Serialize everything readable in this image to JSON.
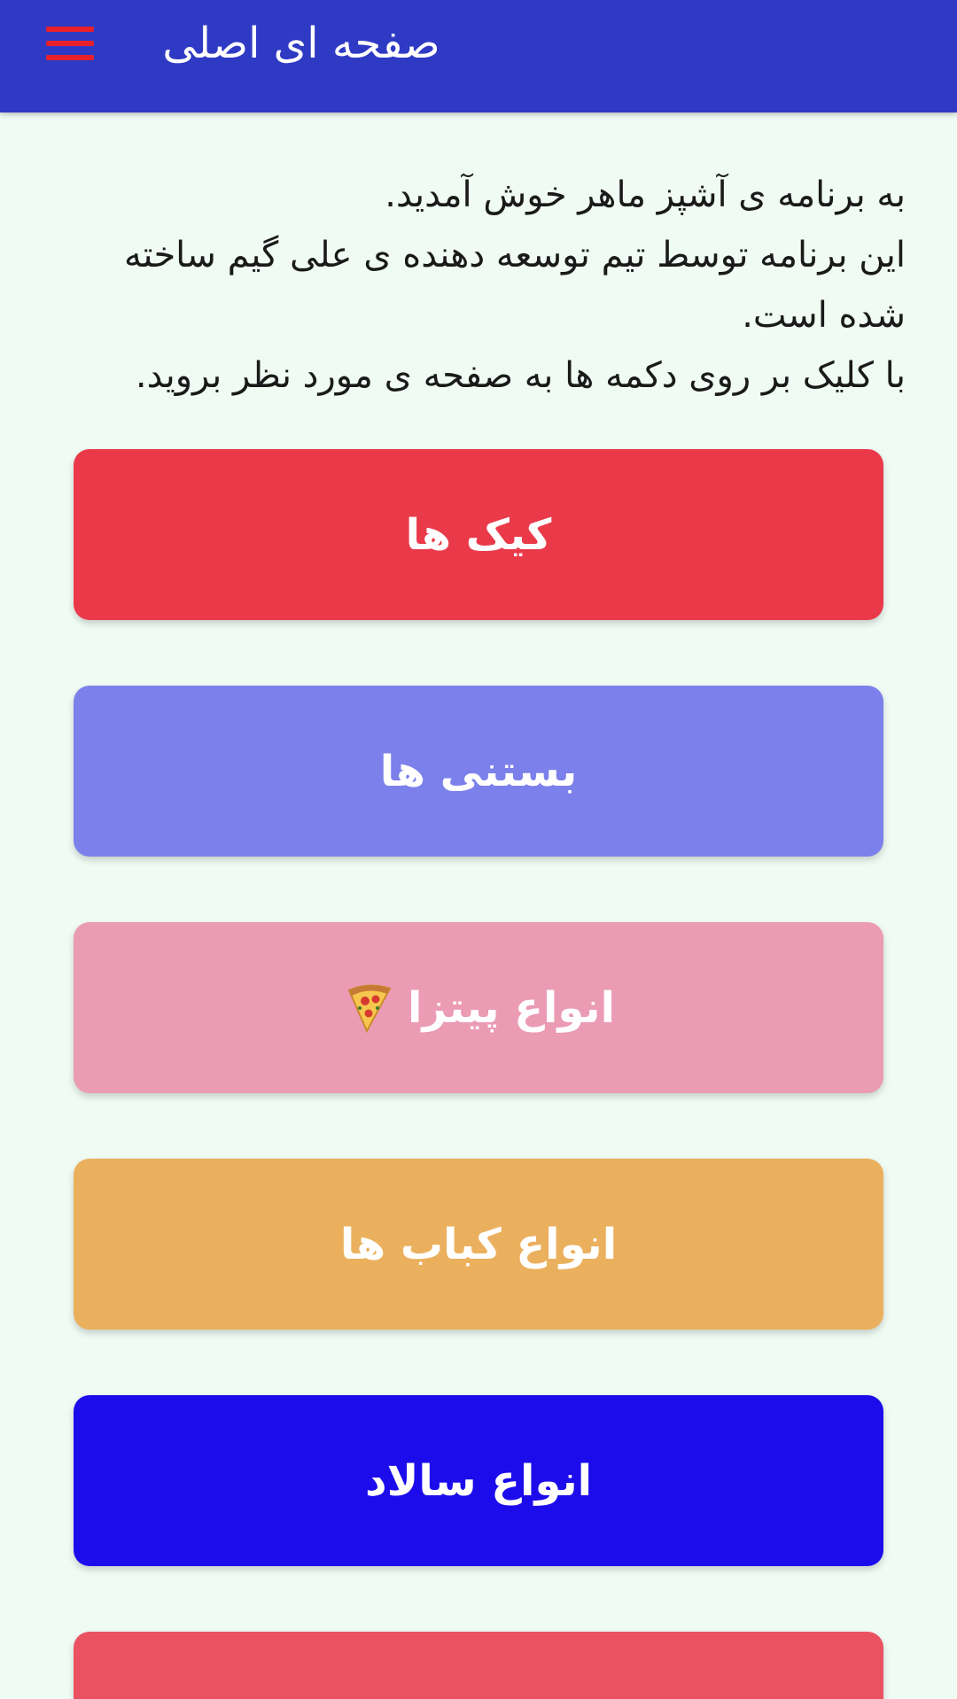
{
  "app_bar": {
    "title": "صفحه ای اصلی",
    "menu_icon": "hamburger-menu-icon",
    "background": "#2f3ac4",
    "menu_color": "#e8202a"
  },
  "intro": {
    "lines": [
      "به برنامه ی آشپز ماهر خوش آمدید.",
      "این برنامه توسط تیم توسعه دهنده ی علی گیم ساخته شده است.",
      "با کلیک بر روی دکمه ها به صفحه ی مورد نظر بروید."
    ]
  },
  "categories": [
    {
      "label": "کیک ها",
      "color": "#ea3a4a"
    },
    {
      "label": "بستنی ها",
      "color": "#7b80ea"
    },
    {
      "label": "انواع پیتزا",
      "color": "#eb9bb4",
      "icon": "pizza-slice-icon"
    },
    {
      "label": "انواع کباب ها",
      "color": "#ebb05d"
    },
    {
      "label": "انواع سالاد",
      "color": "#1c0ceb"
    },
    {
      "label": "",
      "color": "#ea5262"
    }
  ]
}
